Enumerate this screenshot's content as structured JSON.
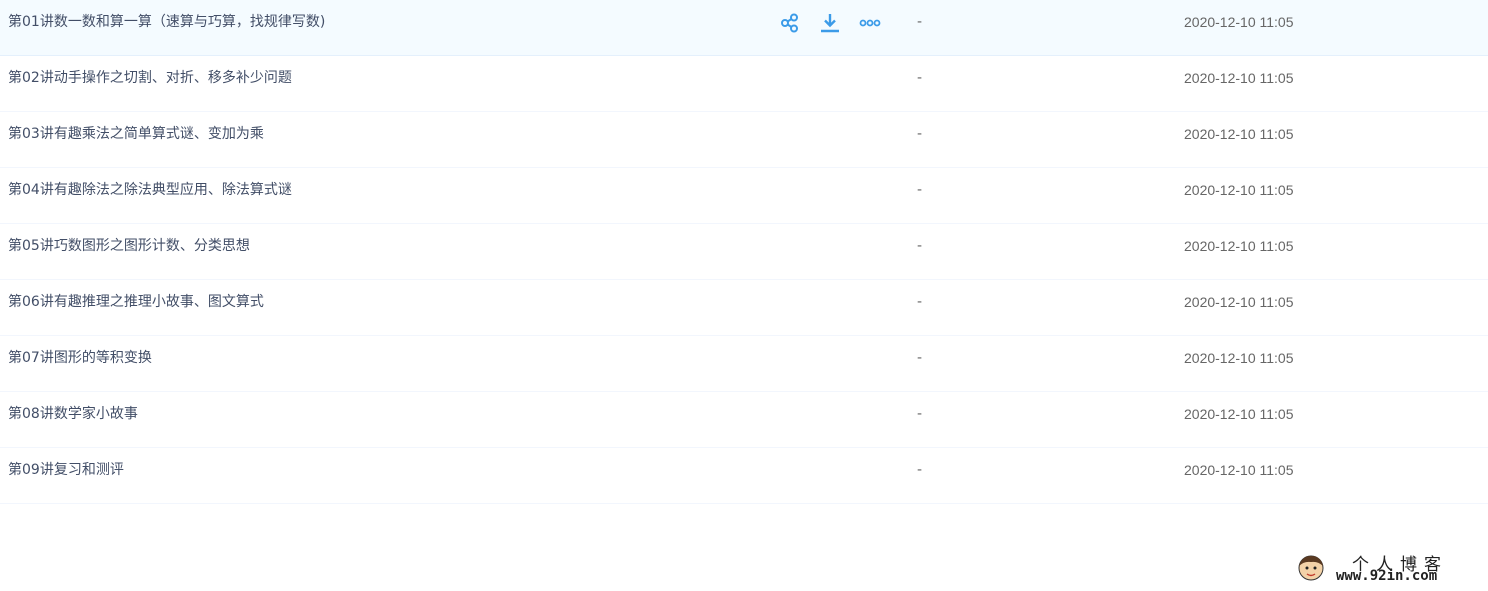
{
  "files": [
    {
      "name": "第01讲数一数和算一算（速算与巧算，找规律写数)",
      "size": "-",
      "modified": "2020-12-10 11:05",
      "hovered": true
    },
    {
      "name": "第02讲动手操作之切割、对折、移多补少问题",
      "size": "-",
      "modified": "2020-12-10 11:05"
    },
    {
      "name": "第03讲有趣乘法之简单算式谜、变加为乘",
      "size": "-",
      "modified": "2020-12-10 11:05"
    },
    {
      "name": "第04讲有趣除法之除法典型应用、除法算式谜",
      "size": "-",
      "modified": "2020-12-10 11:05"
    },
    {
      "name": "第05讲巧数图形之图形计数、分类思想",
      "size": "-",
      "modified": "2020-12-10 11:05"
    },
    {
      "name": "第06讲有趣推理之推理小故事、图文算式",
      "size": "-",
      "modified": "2020-12-10 11:05"
    },
    {
      "name": "第07讲图形的等积变换",
      "size": "-",
      "modified": "2020-12-10 11:05"
    },
    {
      "name": "第08讲数学家小故事",
      "size": "-",
      "modified": "2020-12-10 11:05"
    },
    {
      "name": "第09讲复习和测评",
      "size": "-",
      "modified": "2020-12-10 11:05"
    }
  ],
  "row_actions": [
    {
      "icon": "share-icon"
    },
    {
      "icon": "download-icon"
    },
    {
      "icon": "more-icon"
    }
  ],
  "watermark": {
    "title": "个人博客",
    "url": "www.92in.com"
  },
  "colors": {
    "accent": "#3b9be8",
    "hover_row": "#f4fbff",
    "text": "#424e67"
  }
}
